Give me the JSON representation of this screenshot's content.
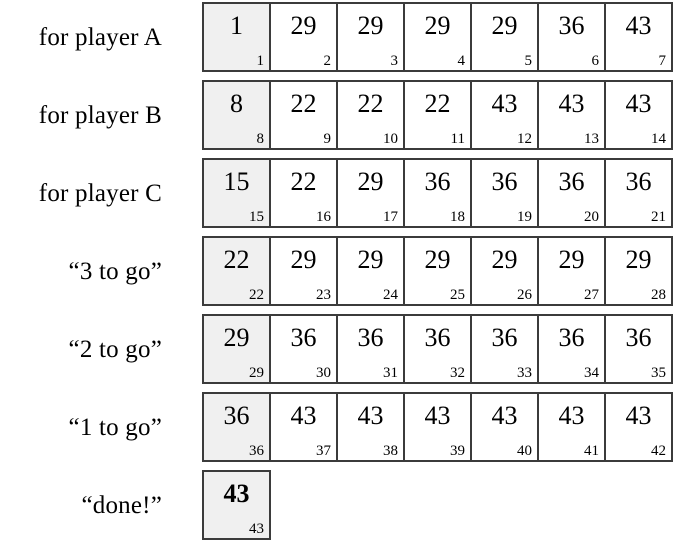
{
  "figure": {
    "cell_shading_color": "#f0f0f0",
    "cell_border_color": "#3b3b3b",
    "background_color": "#ffffff",
    "rows": [
      {
        "label": "for player A",
        "cells": [
          {
            "value": "1",
            "index": "1",
            "shaded": true,
            "bold": false
          },
          {
            "value": "29",
            "index": "2",
            "shaded": false,
            "bold": false
          },
          {
            "value": "29",
            "index": "3",
            "shaded": false,
            "bold": false
          },
          {
            "value": "29",
            "index": "4",
            "shaded": false,
            "bold": false
          },
          {
            "value": "29",
            "index": "5",
            "shaded": false,
            "bold": false
          },
          {
            "value": "36",
            "index": "6",
            "shaded": false,
            "bold": false
          },
          {
            "value": "43",
            "index": "7",
            "shaded": false,
            "bold": false
          }
        ]
      },
      {
        "label": "for player B",
        "cells": [
          {
            "value": "8",
            "index": "8",
            "shaded": true,
            "bold": false
          },
          {
            "value": "22",
            "index": "9",
            "shaded": false,
            "bold": false
          },
          {
            "value": "22",
            "index": "10",
            "shaded": false,
            "bold": false
          },
          {
            "value": "22",
            "index": "11",
            "shaded": false,
            "bold": false
          },
          {
            "value": "43",
            "index": "12",
            "shaded": false,
            "bold": false
          },
          {
            "value": "43",
            "index": "13",
            "shaded": false,
            "bold": false
          },
          {
            "value": "43",
            "index": "14",
            "shaded": false,
            "bold": false
          }
        ]
      },
      {
        "label": "for player C",
        "cells": [
          {
            "value": "15",
            "index": "15",
            "shaded": true,
            "bold": false
          },
          {
            "value": "22",
            "index": "16",
            "shaded": false,
            "bold": false
          },
          {
            "value": "29",
            "index": "17",
            "shaded": false,
            "bold": false
          },
          {
            "value": "36",
            "index": "18",
            "shaded": false,
            "bold": false
          },
          {
            "value": "36",
            "index": "19",
            "shaded": false,
            "bold": false
          },
          {
            "value": "36",
            "index": "20",
            "shaded": false,
            "bold": false
          },
          {
            "value": "36",
            "index": "21",
            "shaded": false,
            "bold": false
          }
        ]
      },
      {
        "label": "“3 to go”",
        "cells": [
          {
            "value": "22",
            "index": "22",
            "shaded": true,
            "bold": false
          },
          {
            "value": "29",
            "index": "23",
            "shaded": false,
            "bold": false
          },
          {
            "value": "29",
            "index": "24",
            "shaded": false,
            "bold": false
          },
          {
            "value": "29",
            "index": "25",
            "shaded": false,
            "bold": false
          },
          {
            "value": "29",
            "index": "26",
            "shaded": false,
            "bold": false
          },
          {
            "value": "29",
            "index": "27",
            "shaded": false,
            "bold": false
          },
          {
            "value": "29",
            "index": "28",
            "shaded": false,
            "bold": false
          }
        ]
      },
      {
        "label": "“2 to go”",
        "cells": [
          {
            "value": "29",
            "index": "29",
            "shaded": true,
            "bold": false
          },
          {
            "value": "36",
            "index": "30",
            "shaded": false,
            "bold": false
          },
          {
            "value": "36",
            "index": "31",
            "shaded": false,
            "bold": false
          },
          {
            "value": "36",
            "index": "32",
            "shaded": false,
            "bold": false
          },
          {
            "value": "36",
            "index": "33",
            "shaded": false,
            "bold": false
          },
          {
            "value": "36",
            "index": "34",
            "shaded": false,
            "bold": false
          },
          {
            "value": "36",
            "index": "35",
            "shaded": false,
            "bold": false
          }
        ]
      },
      {
        "label": "“1 to go”",
        "cells": [
          {
            "value": "36",
            "index": "36",
            "shaded": true,
            "bold": false
          },
          {
            "value": "43",
            "index": "37",
            "shaded": false,
            "bold": false
          },
          {
            "value": "43",
            "index": "38",
            "shaded": false,
            "bold": false
          },
          {
            "value": "43",
            "index": "39",
            "shaded": false,
            "bold": false
          },
          {
            "value": "43",
            "index": "40",
            "shaded": false,
            "bold": false
          },
          {
            "value": "43",
            "index": "41",
            "shaded": false,
            "bold": false
          },
          {
            "value": "43",
            "index": "42",
            "shaded": false,
            "bold": false
          }
        ]
      },
      {
        "label": "“done!”",
        "cells": [
          {
            "value": "43",
            "index": "43",
            "shaded": true,
            "bold": true
          }
        ]
      }
    ]
  }
}
